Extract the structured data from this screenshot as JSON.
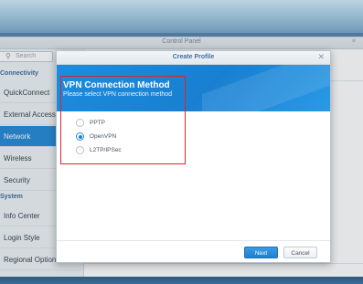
{
  "control_panel": {
    "title": "Control Panel",
    "menu_icon": "≡",
    "search": {
      "placeholder": "Search",
      "icon": "search-icon"
    },
    "sections": [
      {
        "label": "Connectivity"
      },
      {
        "label": "System"
      }
    ],
    "items": [
      {
        "label": "QuickConnect"
      },
      {
        "label": "External Access"
      },
      {
        "label": "Network"
      },
      {
        "label": "Wireless"
      },
      {
        "label": "Security"
      },
      {
        "label": "Info Center"
      },
      {
        "label": "Login Style"
      },
      {
        "label": "Regional Options"
      }
    ],
    "active_item": "Network"
  },
  "dialog": {
    "title": "Create Profile",
    "close_glyph": "✕",
    "heading": "VPN Connection Method",
    "subheading": "Please select VPN connection method",
    "options": [
      {
        "label": "PPTP",
        "checked": false
      },
      {
        "label": "OpenVPN",
        "checked": true
      },
      {
        "label": "L2TP/IPSec",
        "checked": false
      }
    ],
    "buttons": {
      "next": "Next",
      "cancel": "Cancel"
    }
  },
  "colors": {
    "accent": "#1f7fd0",
    "header_blue": "#1a86d8",
    "highlight": "#d6262e"
  }
}
